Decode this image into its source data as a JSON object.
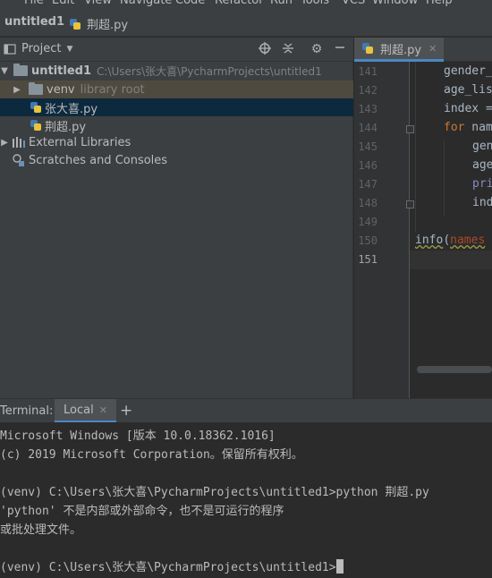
{
  "menu": [
    "File",
    "Edit",
    "View",
    "Navigate",
    "Code",
    "Refactor",
    "Run",
    "Tools",
    "VCS",
    "Window",
    "Help"
  ],
  "nav": {
    "project": "untitled1",
    "file": "荆超.py"
  },
  "project_panel": {
    "title": "Project",
    "tree": [
      {
        "name": "untitled1",
        "path": "C:\\Users\\张大喜\\PycharmProjects\\untitled1"
      },
      {
        "name": "venv",
        "note": "library root"
      },
      {
        "name": "张大喜.py"
      },
      {
        "name": "荆超.py"
      },
      {
        "name": "External Libraries"
      },
      {
        "name": "Scratches and Consoles"
      }
    ]
  },
  "editor": {
    "tab": "荆超.py",
    "line_numbers": [
      "141",
      "142",
      "143",
      "144",
      "145",
      "146",
      "147",
      "148",
      "149",
      "150",
      "151"
    ],
    "lines": {
      "l141": "gender_",
      "l142": "age_lis",
      "l143": "index =",
      "l144_kw": "for",
      "l144_rest": " nam",
      "l145": "gen",
      "l146": "age",
      "l147": "pri",
      "l148": "ind",
      "l150_fn": "info",
      "l150_open": "(",
      "l150_param": "names"
    }
  },
  "terminal": {
    "label": "Terminal:",
    "tab": "Local",
    "add": "+",
    "lines": [
      "Microsoft Windows [版本 10.0.18362.1016]",
      "(c) 2019 Microsoft Corporation。保留所有权利。",
      "",
      "(venv) C:\\Users\\张大喜\\PycharmProjects\\untitled1>python 荆超.py",
      "'python' 不是内部或外部命令，也不是可运行的程序",
      "或批处理文件。",
      "",
      "(venv) C:\\Users\\张大喜\\PycharmProjects\\untitled1>"
    ]
  }
}
